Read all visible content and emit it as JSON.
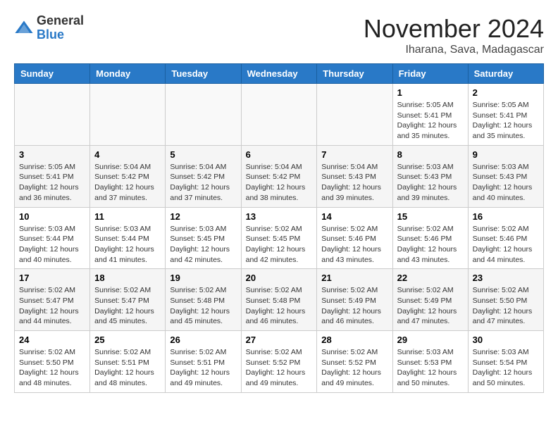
{
  "header": {
    "logo_line1": "General",
    "logo_line2": "Blue",
    "month": "November 2024",
    "location": "Iharana, Sava, Madagascar"
  },
  "weekdays": [
    "Sunday",
    "Monday",
    "Tuesday",
    "Wednesday",
    "Thursday",
    "Friday",
    "Saturday"
  ],
  "weeks": [
    [
      {
        "day": "",
        "info": ""
      },
      {
        "day": "",
        "info": ""
      },
      {
        "day": "",
        "info": ""
      },
      {
        "day": "",
        "info": ""
      },
      {
        "day": "",
        "info": ""
      },
      {
        "day": "1",
        "info": "Sunrise: 5:05 AM\nSunset: 5:41 PM\nDaylight: 12 hours\nand 35 minutes."
      },
      {
        "day": "2",
        "info": "Sunrise: 5:05 AM\nSunset: 5:41 PM\nDaylight: 12 hours\nand 35 minutes."
      }
    ],
    [
      {
        "day": "3",
        "info": "Sunrise: 5:05 AM\nSunset: 5:41 PM\nDaylight: 12 hours\nand 36 minutes."
      },
      {
        "day": "4",
        "info": "Sunrise: 5:04 AM\nSunset: 5:42 PM\nDaylight: 12 hours\nand 37 minutes."
      },
      {
        "day": "5",
        "info": "Sunrise: 5:04 AM\nSunset: 5:42 PM\nDaylight: 12 hours\nand 37 minutes."
      },
      {
        "day": "6",
        "info": "Sunrise: 5:04 AM\nSunset: 5:42 PM\nDaylight: 12 hours\nand 38 minutes."
      },
      {
        "day": "7",
        "info": "Sunrise: 5:04 AM\nSunset: 5:43 PM\nDaylight: 12 hours\nand 39 minutes."
      },
      {
        "day": "8",
        "info": "Sunrise: 5:03 AM\nSunset: 5:43 PM\nDaylight: 12 hours\nand 39 minutes."
      },
      {
        "day": "9",
        "info": "Sunrise: 5:03 AM\nSunset: 5:43 PM\nDaylight: 12 hours\nand 40 minutes."
      }
    ],
    [
      {
        "day": "10",
        "info": "Sunrise: 5:03 AM\nSunset: 5:44 PM\nDaylight: 12 hours\nand 40 minutes."
      },
      {
        "day": "11",
        "info": "Sunrise: 5:03 AM\nSunset: 5:44 PM\nDaylight: 12 hours\nand 41 minutes."
      },
      {
        "day": "12",
        "info": "Sunrise: 5:03 AM\nSunset: 5:45 PM\nDaylight: 12 hours\nand 42 minutes."
      },
      {
        "day": "13",
        "info": "Sunrise: 5:02 AM\nSunset: 5:45 PM\nDaylight: 12 hours\nand 42 minutes."
      },
      {
        "day": "14",
        "info": "Sunrise: 5:02 AM\nSunset: 5:46 PM\nDaylight: 12 hours\nand 43 minutes."
      },
      {
        "day": "15",
        "info": "Sunrise: 5:02 AM\nSunset: 5:46 PM\nDaylight: 12 hours\nand 43 minutes."
      },
      {
        "day": "16",
        "info": "Sunrise: 5:02 AM\nSunset: 5:46 PM\nDaylight: 12 hours\nand 44 minutes."
      }
    ],
    [
      {
        "day": "17",
        "info": "Sunrise: 5:02 AM\nSunset: 5:47 PM\nDaylight: 12 hours\nand 44 minutes."
      },
      {
        "day": "18",
        "info": "Sunrise: 5:02 AM\nSunset: 5:47 PM\nDaylight: 12 hours\nand 45 minutes."
      },
      {
        "day": "19",
        "info": "Sunrise: 5:02 AM\nSunset: 5:48 PM\nDaylight: 12 hours\nand 45 minutes."
      },
      {
        "day": "20",
        "info": "Sunrise: 5:02 AM\nSunset: 5:48 PM\nDaylight: 12 hours\nand 46 minutes."
      },
      {
        "day": "21",
        "info": "Sunrise: 5:02 AM\nSunset: 5:49 PM\nDaylight: 12 hours\nand 46 minutes."
      },
      {
        "day": "22",
        "info": "Sunrise: 5:02 AM\nSunset: 5:49 PM\nDaylight: 12 hours\nand 47 minutes."
      },
      {
        "day": "23",
        "info": "Sunrise: 5:02 AM\nSunset: 5:50 PM\nDaylight: 12 hours\nand 47 minutes."
      }
    ],
    [
      {
        "day": "24",
        "info": "Sunrise: 5:02 AM\nSunset: 5:50 PM\nDaylight: 12 hours\nand 48 minutes."
      },
      {
        "day": "25",
        "info": "Sunrise: 5:02 AM\nSunset: 5:51 PM\nDaylight: 12 hours\nand 48 minutes."
      },
      {
        "day": "26",
        "info": "Sunrise: 5:02 AM\nSunset: 5:51 PM\nDaylight: 12 hours\nand 49 minutes."
      },
      {
        "day": "27",
        "info": "Sunrise: 5:02 AM\nSunset: 5:52 PM\nDaylight: 12 hours\nand 49 minutes."
      },
      {
        "day": "28",
        "info": "Sunrise: 5:02 AM\nSunset: 5:52 PM\nDaylight: 12 hours\nand 49 minutes."
      },
      {
        "day": "29",
        "info": "Sunrise: 5:03 AM\nSunset: 5:53 PM\nDaylight: 12 hours\nand 50 minutes."
      },
      {
        "day": "30",
        "info": "Sunrise: 5:03 AM\nSunset: 5:54 PM\nDaylight: 12 hours\nand 50 minutes."
      }
    ]
  ]
}
